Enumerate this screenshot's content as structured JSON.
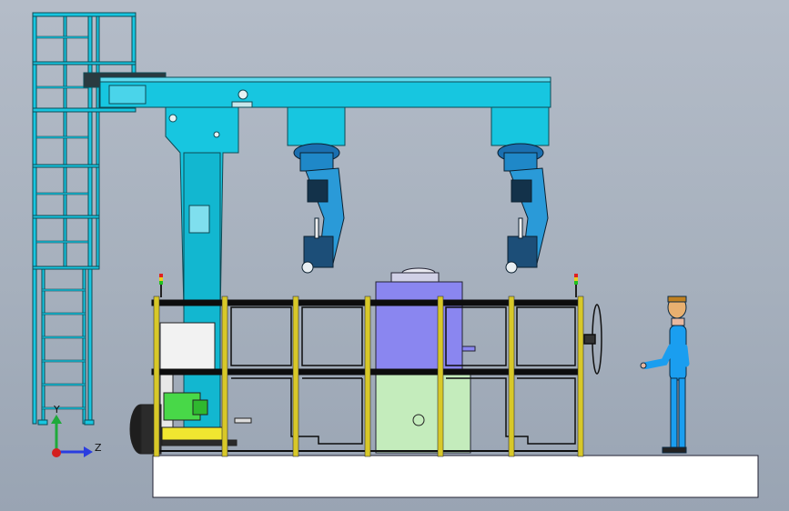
{
  "axis_triad": {
    "y_label": "Y",
    "z_label": "Z",
    "y_color": "#1faa3a",
    "z_color": "#2a3de0",
    "x_color": "#d42020"
  },
  "colors": {
    "background": "#a9b3c0",
    "structure": "#17c6e0",
    "fence": "#0d0d0d",
    "fence_post": "#d8c828",
    "cabinet_violet": "#8a86f0",
    "cabinet_green": "#c4ecbc",
    "operator": "#1a9ef0",
    "positioner_green": "#48d848",
    "conveyor_yellow": "#f0e630",
    "floor": "#ffffff"
  },
  "icons": {
    "robot_left": "welding-robot-icon",
    "robot_right": "welding-robot-icon",
    "operator": "operator-figure-icon",
    "beacon": "signal-tower-icon"
  }
}
